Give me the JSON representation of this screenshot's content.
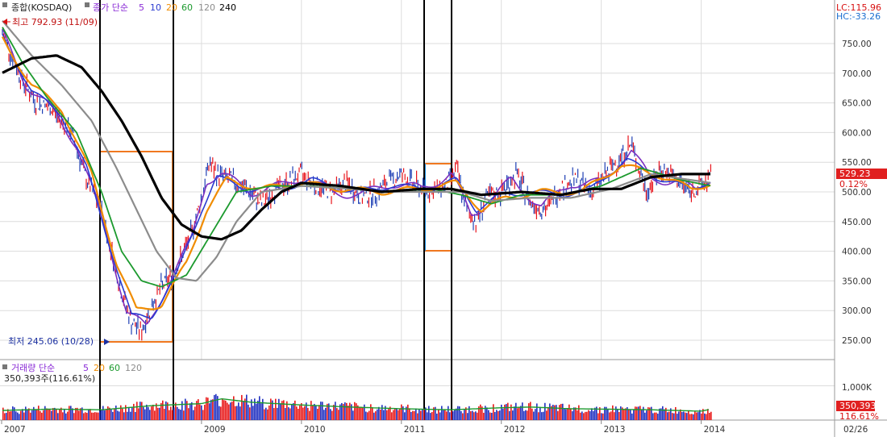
{
  "colors": {
    "candle_up": "#e8141c",
    "candle_down": "#1f3fb4",
    "ma5": "#7b2fbf",
    "ma10": "#2b3bd0",
    "ma20": "#f08c00",
    "ma60": "#1c9a2e",
    "ma120": "#8c8c8c",
    "ma240": "#000000",
    "box": "#f07820",
    "box_blue": "#2090e0",
    "lc": "#d81010",
    "hc": "#1a6fd0",
    "grid": "#dcdcdc",
    "vol_bar_up": "#e81818",
    "vol_bar_down": "#2030c0"
  },
  "header": {
    "instrument": "종합(KOSDAQ)",
    "ma_title": "종가 단순",
    "ma_periods": [
      "5",
      "10",
      "20",
      "60",
      "120",
      "240"
    ],
    "lc": "LC:115.96",
    "hc": "HC:-33.26"
  },
  "annotations": {
    "high": "최고 792.93 (11/09)",
    "low": "최저 245.06 (10/28)"
  },
  "current": {
    "price": "529.23",
    "change": "0.12%"
  },
  "volume_panel": {
    "title": "거래량 단순",
    "periods": [
      "5",
      "20",
      "60",
      "120"
    ],
    "value": "350,393주(116.61%)",
    "scale": "1,000K",
    "badge_value": "350,393",
    "badge_pct": "116.61%"
  },
  "footer": {
    "end_label": "02/26"
  },
  "chart_data": {
    "type": "line",
    "title": "",
    "x_ticks": [
      "2007",
      "2009",
      "2010",
      "2011",
      "2012",
      "2013",
      "2014"
    ],
    "y_ticks": [
      "250.00",
      "300.00",
      "350.00",
      "400.00",
      "450.00",
      "500.00",
      "550.00",
      "600.00",
      "650.00",
      "700.00",
      "750.00"
    ],
    "ylim": [
      220,
      800
    ],
    "grid": true,
    "price_path": [
      [
        2007.0,
        770
      ],
      [
        2007.2,
        690
      ],
      [
        2007.35,
        650
      ],
      [
        2007.5,
        640
      ],
      [
        2007.7,
        600
      ],
      [
        2007.85,
        520
      ],
      [
        2008.0,
        470
      ],
      [
        2008.1,
        400
      ],
      [
        2008.2,
        330
      ],
      [
        2008.3,
        280
      ],
      [
        2008.4,
        265
      ],
      [
        2008.5,
        310
      ],
      [
        2008.6,
        340
      ],
      [
        2008.7,
        360
      ],
      [
        2008.8,
        390
      ],
      [
        2008.9,
        430
      ],
      [
        2009.0,
        490
      ],
      [
        2009.08,
        550
      ],
      [
        2009.15,
        530
      ],
      [
        2009.3,
        520
      ],
      [
        2009.45,
        505
      ],
      [
        2009.6,
        480
      ],
      [
        2009.75,
        505
      ],
      [
        2009.9,
        520
      ],
      [
        2010.0,
        530
      ],
      [
        2010.15,
        510
      ],
      [
        2010.3,
        500
      ],
      [
        2010.45,
        515
      ],
      [
        2010.6,
        490
      ],
      [
        2010.75,
        500
      ],
      [
        2010.9,
        520
      ],
      [
        2011.0,
        530
      ],
      [
        2011.15,
        510
      ],
      [
        2011.3,
        500
      ],
      [
        2011.45,
        510
      ],
      [
        2011.55,
        540
      ],
      [
        2011.65,
        470
      ],
      [
        2011.75,
        450
      ],
      [
        2011.85,
        490
      ],
      [
        2012.0,
        500
      ],
      [
        2012.15,
        530
      ],
      [
        2012.3,
        480
      ],
      [
        2012.45,
        470
      ],
      [
        2012.6,
        510
      ],
      [
        2012.75,
        520
      ],
      [
        2012.9,
        500
      ],
      [
        2013.05,
        530
      ],
      [
        2013.2,
        560
      ],
      [
        2013.3,
        580
      ],
      [
        2013.45,
        500
      ],
      [
        2013.6,
        540
      ],
      [
        2013.75,
        520
      ],
      [
        2013.9,
        500
      ],
      [
        2014.0,
        510
      ],
      [
        2014.1,
        529
      ]
    ],
    "series": [
      {
        "name": "5",
        "points": [
          [
            2007.0,
            770
          ],
          [
            2007.25,
            680
          ],
          [
            2007.5,
            640
          ],
          [
            2007.75,
            580
          ],
          [
            2008.0,
            460
          ],
          [
            2008.25,
            300
          ],
          [
            2008.45,
            270
          ],
          [
            2008.65,
            340
          ],
          [
            2008.9,
            420
          ],
          [
            2009.05,
            520
          ],
          [
            2009.2,
            530
          ],
          [
            2009.5,
            500
          ],
          [
            2009.8,
            510
          ],
          [
            2010.0,
            525
          ],
          [
            2010.3,
            500
          ],
          [
            2010.6,
            495
          ],
          [
            2010.9,
            515
          ],
          [
            2011.2,
            505
          ],
          [
            2011.5,
            530
          ],
          [
            2011.7,
            460
          ],
          [
            2011.85,
            480
          ],
          [
            2012.1,
            520
          ],
          [
            2012.4,
            475
          ],
          [
            2012.7,
            515
          ],
          [
            2013.0,
            515
          ],
          [
            2013.3,
            570
          ],
          [
            2013.5,
            520
          ],
          [
            2013.75,
            520
          ],
          [
            2013.95,
            500
          ],
          [
            2014.1,
            525
          ]
        ]
      },
      {
        "name": "10",
        "points": [
          [
            2007.0,
            765
          ],
          [
            2007.3,
            670
          ],
          [
            2007.6,
            630
          ],
          [
            2007.85,
            540
          ],
          [
            2008.1,
            400
          ],
          [
            2008.3,
            290
          ],
          [
            2008.5,
            290
          ],
          [
            2008.75,
            360
          ],
          [
            2009.0,
            470
          ],
          [
            2009.15,
            525
          ],
          [
            2009.45,
            505
          ],
          [
            2009.8,
            505
          ],
          [
            2010.1,
            520
          ],
          [
            2010.5,
            500
          ],
          [
            2010.9,
            510
          ],
          [
            2011.3,
            505
          ],
          [
            2011.55,
            520
          ],
          [
            2011.75,
            470
          ],
          [
            2012.0,
            495
          ],
          [
            2012.3,
            500
          ],
          [
            2012.6,
            495
          ],
          [
            2012.9,
            505
          ],
          [
            2013.25,
            555
          ],
          [
            2013.55,
            525
          ],
          [
            2013.9,
            505
          ],
          [
            2014.1,
            520
          ]
        ]
      },
      {
        "name": "20",
        "points": [
          [
            2007.0,
            760
          ],
          [
            2007.3,
            680
          ],
          [
            2007.6,
            640
          ],
          [
            2007.9,
            530
          ],
          [
            2008.15,
            380
          ],
          [
            2008.35,
            300
          ],
          [
            2008.6,
            310
          ],
          [
            2008.85,
            380
          ],
          [
            2009.05,
            470
          ],
          [
            2009.25,
            520
          ],
          [
            2009.6,
            505
          ],
          [
            2010.0,
            515
          ],
          [
            2010.4,
            505
          ],
          [
            2010.8,
            500
          ],
          [
            2011.2,
            505
          ],
          [
            2011.55,
            515
          ],
          [
            2011.8,
            470
          ],
          [
            2012.05,
            490
          ],
          [
            2012.4,
            500
          ],
          [
            2012.8,
            500
          ],
          [
            2013.2,
            545
          ],
          [
            2013.55,
            530
          ],
          [
            2013.9,
            505
          ],
          [
            2014.1,
            515
          ]
        ]
      },
      {
        "name": "60",
        "points": [
          [
            2007.0,
            780
          ],
          [
            2007.2,
            720
          ],
          [
            2007.45,
            660
          ],
          [
            2007.75,
            600
          ],
          [
            2008.0,
            500
          ],
          [
            2008.2,
            400
          ],
          [
            2008.4,
            350
          ],
          [
            2008.6,
            340
          ],
          [
            2008.85,
            360
          ],
          [
            2009.1,
            430
          ],
          [
            2009.35,
            500
          ],
          [
            2009.7,
            510
          ],
          [
            2010.1,
            510
          ],
          [
            2010.5,
            505
          ],
          [
            2010.9,
            500
          ],
          [
            2011.3,
            505
          ],
          [
            2011.6,
            495
          ],
          [
            2011.9,
            480
          ],
          [
            2012.2,
            495
          ],
          [
            2012.6,
            495
          ],
          [
            2013.0,
            510
          ],
          [
            2013.4,
            540
          ],
          [
            2013.8,
            520
          ],
          [
            2014.1,
            510
          ]
        ]
      },
      {
        "name": "120",
        "points": [
          [
            2007.0,
            790
          ],
          [
            2007.3,
            730
          ],
          [
            2007.6,
            680
          ],
          [
            2007.9,
            620
          ],
          [
            2008.15,
            540
          ],
          [
            2008.35,
            470
          ],
          [
            2008.55,
            400
          ],
          [
            2008.75,
            355
          ],
          [
            2008.95,
            350
          ],
          [
            2009.15,
            390
          ],
          [
            2009.35,
            450
          ],
          [
            2009.6,
            500
          ],
          [
            2010.0,
            510
          ],
          [
            2010.5,
            505
          ],
          [
            2010.9,
            500
          ],
          [
            2011.3,
            500
          ],
          [
            2011.6,
            500
          ],
          [
            2011.9,
            485
          ],
          [
            2012.3,
            490
          ],
          [
            2012.7,
            490
          ],
          [
            2013.1,
            505
          ],
          [
            2013.5,
            530
          ],
          [
            2013.9,
            520
          ],
          [
            2014.1,
            515
          ]
        ]
      },
      {
        "name": "240",
        "points": [
          [
            2007.0,
            700
          ],
          [
            2007.3,
            725
          ],
          [
            2007.55,
            730
          ],
          [
            2007.8,
            710
          ],
          [
            2008.0,
            670
          ],
          [
            2008.2,
            620
          ],
          [
            2008.4,
            560
          ],
          [
            2008.6,
            490
          ],
          [
            2008.8,
            445
          ],
          [
            2009.0,
            425
          ],
          [
            2009.2,
            420
          ],
          [
            2009.4,
            435
          ],
          [
            2009.6,
            470
          ],
          [
            2009.8,
            500
          ],
          [
            2010.0,
            515
          ],
          [
            2010.4,
            510
          ],
          [
            2010.8,
            500
          ],
          [
            2011.2,
            505
          ],
          [
            2011.5,
            505
          ],
          [
            2011.8,
            495
          ],
          [
            2012.2,
            500
          ],
          [
            2012.6,
            495
          ],
          [
            2012.9,
            505
          ],
          [
            2013.2,
            505
          ],
          [
            2013.5,
            525
          ],
          [
            2013.8,
            530
          ],
          [
            2014.1,
            530
          ]
        ]
      }
    ],
    "volume_ylim": [
      0,
      1200
    ],
    "volume_envelope": [
      [
        2007.0,
        280
      ],
      [
        2007.5,
        320
      ],
      [
        2008.0,
        300
      ],
      [
        2008.5,
        420
      ],
      [
        2009.0,
        480
      ],
      [
        2009.2,
        620
      ],
      [
        2009.5,
        520
      ],
      [
        2010.0,
        440
      ],
      [
        2010.5,
        380
      ],
      [
        2011.0,
        330
      ],
      [
        2011.5,
        300
      ],
      [
        2012.0,
        360
      ],
      [
        2012.3,
        380
      ],
      [
        2012.7,
        330
      ],
      [
        2013.0,
        320
      ],
      [
        2013.5,
        300
      ],
      [
        2014.0,
        260
      ],
      [
        2014.1,
        320
      ]
    ]
  }
}
